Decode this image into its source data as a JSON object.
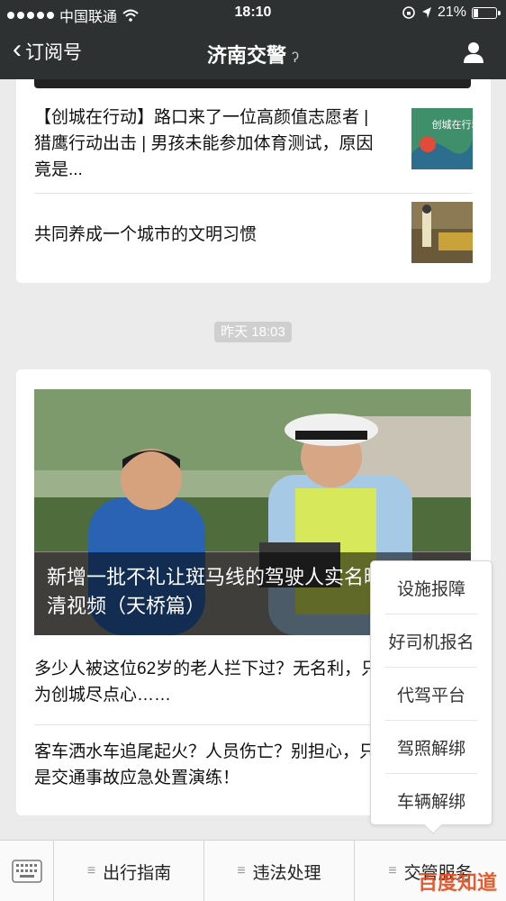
{
  "status_bar": {
    "carrier": "中国联通",
    "time": "18:10",
    "battery": "21%",
    "battery_level": 0.21
  },
  "nav": {
    "back_label": "订阅号",
    "title": "济南交警"
  },
  "feed": {
    "card1_items": [
      {
        "title": "【创城在行动】路口来了一位高颜值志愿者 | 猎鹰行动出击 | 男孩未能参加体育测试，原因竟是...",
        "thumb_text": "创城在行动"
      },
      {
        "title": "共同养成一个城市的文明习惯",
        "thumb_text": ""
      }
    ],
    "timestamp": "昨天 18:03",
    "card2": {
      "hero_caption": "新增一批不礼让斑马线的驾驶人实名曝光附高清视频（天桥篇）",
      "items": [
        {
          "title": "多少人被这位62岁的老人拦下过？无名利，只为创城尽点心……"
        },
        {
          "title": "客车洒水车追尾起火？人员伤亡？别担心，只是交通事故应急处置演练！"
        }
      ]
    }
  },
  "popup_menu": {
    "items": [
      "设施报障",
      "好司机报名",
      "代驾平台",
      "驾照解绑",
      "车辆解绑"
    ]
  },
  "bottom_bar": {
    "tabs": [
      "出行指南",
      "违法处理",
      "交管服务"
    ]
  },
  "watermark": "百度知道"
}
